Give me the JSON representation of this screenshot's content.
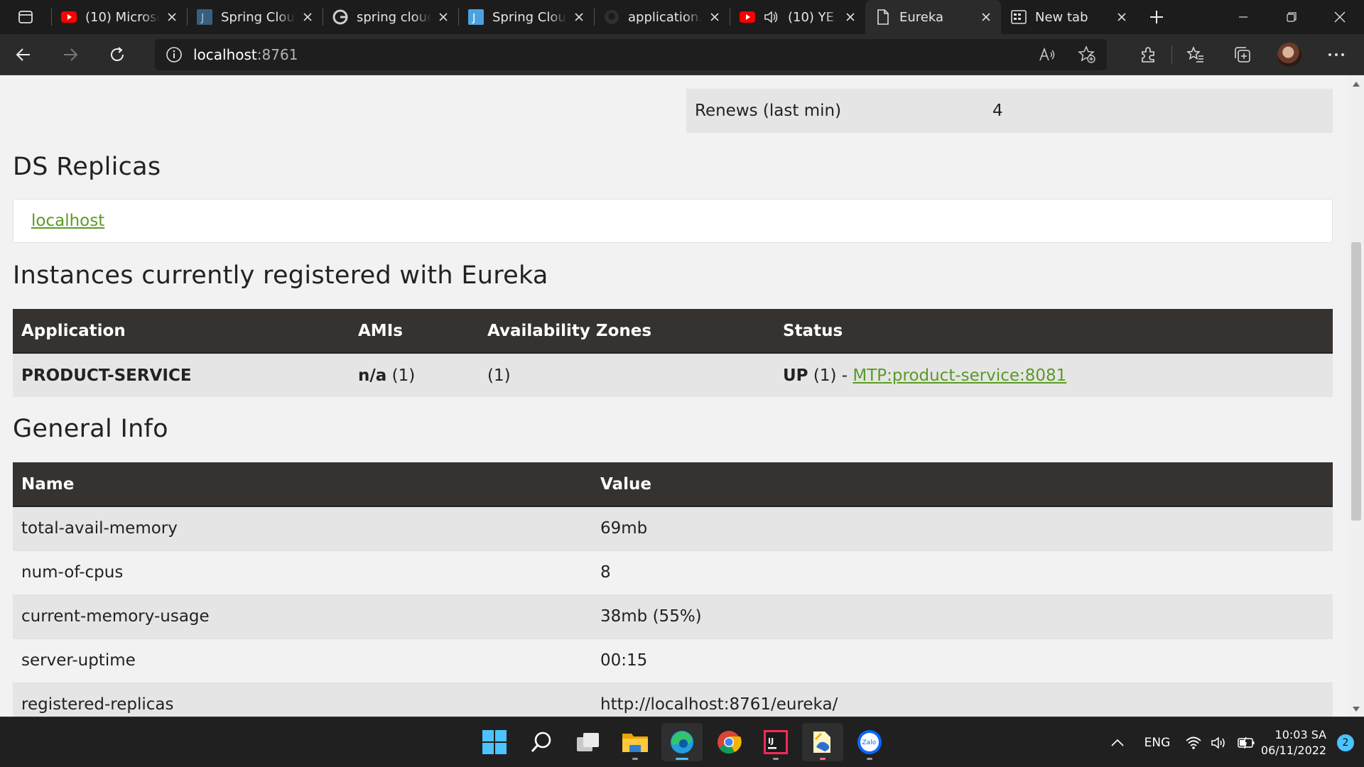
{
  "browser": {
    "tabs": [
      {
        "title": "(10) Microsoft",
        "icon": "youtube-icon"
      },
      {
        "title": "Spring Cloud",
        "icon": "javadoc-icon"
      },
      {
        "title": "spring cloud",
        "icon": "google-icon"
      },
      {
        "title": "Spring Cloud",
        "icon": "javadoc-icon"
      },
      {
        "title": "application.",
        "icon": "github-icon"
      },
      {
        "title": "(10) YE",
        "icon": "youtube-icon"
      },
      {
        "title": "Eureka",
        "icon": "page-icon",
        "active": true
      },
      {
        "title": "New tab",
        "icon": "newtab-icon"
      }
    ],
    "url_host": "localhost",
    "url_port": ":8761"
  },
  "page": {
    "renews_label": "Renews (last min)",
    "renews_value": "4",
    "ds_replicas_title": "DS Replicas",
    "ds_replica_link": "localhost",
    "instances_title": "Instances currently registered with Eureka",
    "instances_headers": [
      "Application",
      "AMIs",
      "Availability Zones",
      "Status"
    ],
    "instances": [
      {
        "application": "PRODUCT-SERVICE",
        "amis_bold": "n/a",
        "amis_count": "(1)",
        "zones": "(1)",
        "status_prefix": "UP",
        "status_count": "(1) -",
        "status_link": "MTP:product-service:8081"
      }
    ],
    "general_info_title": "General Info",
    "general_headers": [
      "Name",
      "Value"
    ],
    "general_info": [
      {
        "name": "total-avail-memory",
        "value": "69mb"
      },
      {
        "name": "num-of-cpus",
        "value": "8"
      },
      {
        "name": "current-memory-usage",
        "value": "38mb (55%)"
      },
      {
        "name": "server-uptime",
        "value": "00:15"
      },
      {
        "name": "registered-replicas",
        "value": "http://localhost:8761/eureka/"
      }
    ]
  },
  "taskbar": {
    "apps": [
      "start-icon",
      "search-icon",
      "task-view-icon",
      "file-explorer-icon",
      "edge-icon",
      "chrome-icon",
      "intellij-icon",
      "paint-icon",
      "zalo-icon"
    ],
    "lang": "ENG",
    "time": "10:03 SA",
    "date": "06/11/2022",
    "notifications": "2"
  },
  "colors": {
    "link": "#5b9a27",
    "table_header": "#353230",
    "accent": "#4cc2ff"
  }
}
